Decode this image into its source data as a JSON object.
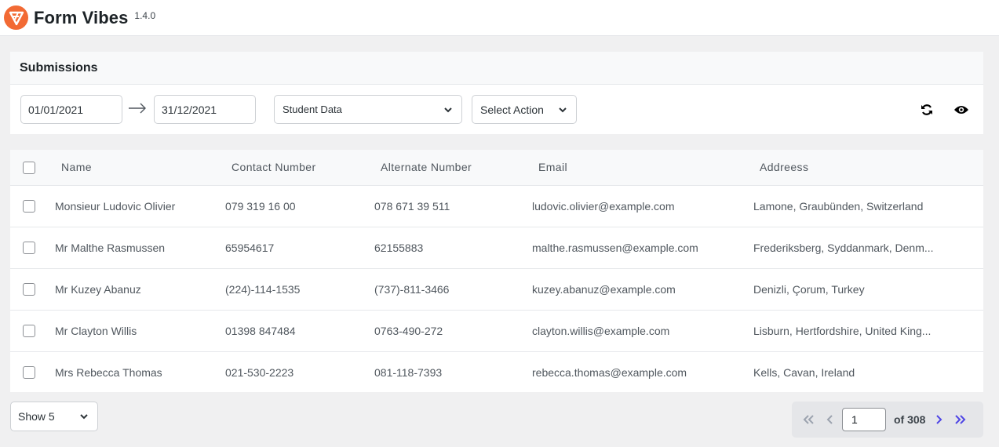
{
  "app": {
    "title": "Form Vibes",
    "version": "1.4.0",
    "logo_color": "#f26a34"
  },
  "filters": {
    "section_title": "Submissions",
    "date_from": "01/01/2021",
    "date_to": "31/12/2021",
    "form_select": "Student Data",
    "action_select": "Select Action",
    "icons": [
      "refresh-icon",
      "eye-icon"
    ]
  },
  "table": {
    "columns": [
      "Name",
      "Contact Number",
      "Alternate Number",
      "Email",
      "Addreess"
    ],
    "rows": [
      {
        "name": "Monsieur Ludovic Olivier",
        "contact": "079 319 16 00",
        "alternate": "078 671 39 511",
        "email": "ludovic.olivier@example.com",
        "address": "Lamone, Graubünden, Switzerland"
      },
      {
        "name": "Mr Malthe Rasmussen",
        "contact": "65954617",
        "alternate": "62155883",
        "email": "malthe.rasmussen@example.com",
        "address": "Frederiksberg, Syddanmark, Denm..."
      },
      {
        "name": "Mr Kuzey Abanuz",
        "contact": "(224)-114-1535",
        "alternate": "(737)-811-3466",
        "email": "kuzey.abanuz@example.com",
        "address": "Denizli, Çorum, Turkey"
      },
      {
        "name": "Mr Clayton Willis",
        "contact": "01398 847484",
        "alternate": "0763-490-272",
        "email": "clayton.willis@example.com",
        "address": "Lisburn, Hertfordshire, United King..."
      },
      {
        "name": "Mrs Rebecca Thomas",
        "contact": "021-530-2223",
        "alternate": "081-118-7393",
        "email": "rebecca.thomas@example.com",
        "address": "Kells, Cavan, Ireland"
      }
    ]
  },
  "footer": {
    "page_size_label": "Show 5",
    "current_page": "1",
    "total_pages_label": "of 308",
    "active_nav_color": "#4f46e5",
    "disabled_nav_color": "#9ca3af"
  }
}
